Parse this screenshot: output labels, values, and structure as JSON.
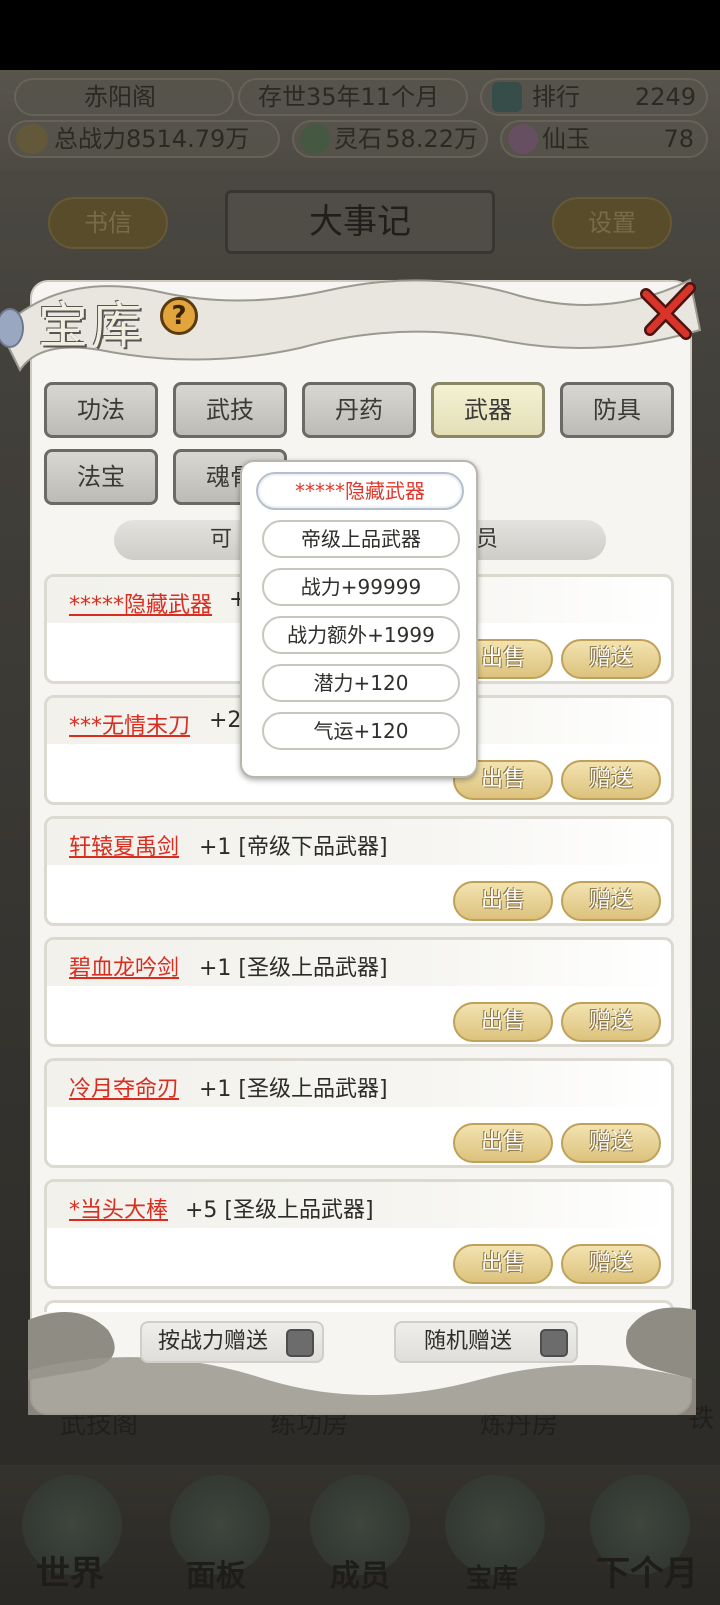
{
  "header": {
    "sect_name": "赤阳阁",
    "age": "存世35年11个月",
    "rank_label": "排行",
    "rank_value": "2249",
    "power_label": "总战力8514.79万",
    "spirit_stone_label": "灵石",
    "spirit_stone_value": "58.22万",
    "jade_label": "仙玉",
    "jade_value": "78"
  },
  "top_buttons": {
    "letters": "书信",
    "events": "大事记",
    "settings": "设置"
  },
  "modal": {
    "title": "宝库",
    "help": "?",
    "tabs_row1": [
      "功法",
      "武技",
      "丹药",
      "武器",
      "防具"
    ],
    "tabs_row2": [
      "法宝",
      "魂骨"
    ],
    "active_tab": "武器",
    "filter_left": "可",
    "filter_right": "员",
    "items": [
      {
        "name": "*****隐藏武器",
        "extra": "+"
      },
      {
        "name": "***无情末刀",
        "extra": "+2"
      },
      {
        "name": "轩辕夏禹剑",
        "extra": "+1 [帝级下品武器]"
      },
      {
        "name": "碧血龙吟剑",
        "extra": "+1 [圣级上品武器]"
      },
      {
        "name": "冷月夺命刃",
        "extra": "+1 [圣级上品武器]"
      },
      {
        "name": "*当头大棒",
        "extra": "+5 [圣级上品武器]"
      }
    ],
    "sell_label": "出售",
    "gift_label": "赠送",
    "toggle_power": "按战力赠送",
    "toggle_random": "随机赠送"
  },
  "popup": {
    "title": "*****隐藏武器",
    "grade": "帝级上品武器",
    "stats": [
      "战力+99999",
      "战力额外+1999",
      "潜力+120",
      "气运+120"
    ]
  },
  "bottom_nav": {
    "world": "世界",
    "panel": "面板",
    "members": "成员",
    "treasury": "宝库",
    "next_month": "下个月"
  },
  "behind_rooms": [
    "武技阁",
    "练功房",
    "炼丹房",
    "铁"
  ]
}
